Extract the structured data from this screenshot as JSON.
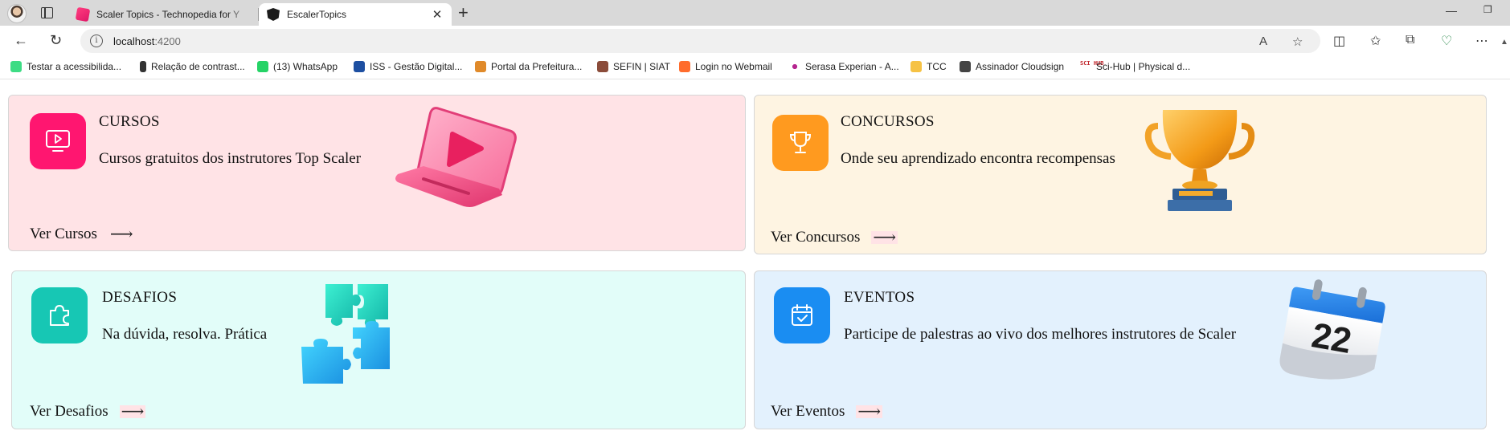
{
  "browser": {
    "tabs": [
      {
        "title": "Scaler Topics - Technopedia for Y",
        "icon": "scaler-icon",
        "active": false
      },
      {
        "title": "EscalerTopics",
        "icon": "angular-icon",
        "active": true
      }
    ],
    "address": {
      "host": "localhost",
      "port": ":4200"
    },
    "bookmarks": [
      {
        "label": "Testar a acessibilida...",
        "icon": "android-icon"
      },
      {
        "label": "Relação de contrast...",
        "icon": "book-icon"
      },
      {
        "label": "(13) WhatsApp",
        "icon": "whatsapp-icon"
      },
      {
        "label": "ISS - Gestão Digital...",
        "icon": "iss-icon"
      },
      {
        "label": "Portal da Prefeitura...",
        "icon": "portal-icon"
      },
      {
        "label": "SEFIN | SIAT",
        "icon": "sefin-icon"
      },
      {
        "label": "Login no Webmail",
        "icon": "cpanel-icon"
      },
      {
        "label": "Serasa Experian - A...",
        "icon": "serasa-icon"
      },
      {
        "label": "TCC",
        "icon": "folder-icon"
      },
      {
        "label": "Assinador Cloudsign",
        "icon": "cloudsign-icon"
      },
      {
        "label": "Sci-Hub | Physical d...",
        "icon": "scihub-icon",
        "icon_text": "SCI HUB"
      }
    ]
  },
  "cards": [
    {
      "title": "CURSOS",
      "description": "Cursos gratuitos dos instrutores Top Scaler",
      "link": "Ver Cursos",
      "arrow": "⟶",
      "icon": "monitor-play-icon",
      "accent": "#ff1670",
      "background": "#ffe3e6"
    },
    {
      "title": "CONCURSOS",
      "description": "Onde seu aprendizado encontra recompensas",
      "link": "Ver Concursos",
      "arrow": "⟶",
      "icon": "trophy-icon",
      "accent": "#ff9a1f",
      "background": "#fef4e2"
    },
    {
      "title": "DESAFIOS",
      "description": "Na dúvida, resolva. Prática",
      "link": "Ver Desafios",
      "arrow": "⟶",
      "icon": "puzzle-icon",
      "accent": "#17c7b4",
      "background": "#e2fdf9"
    },
    {
      "title": "EVENTOS",
      "description": "Participe de palestras ao vivo dos melhores instrutores de Scaler",
      "link": "Ver Eventos",
      "arrow": "⟶",
      "icon": "calendar-icon",
      "accent": "#1a8df2",
      "background": "#e3f1fd",
      "calendar_day": "22"
    }
  ]
}
